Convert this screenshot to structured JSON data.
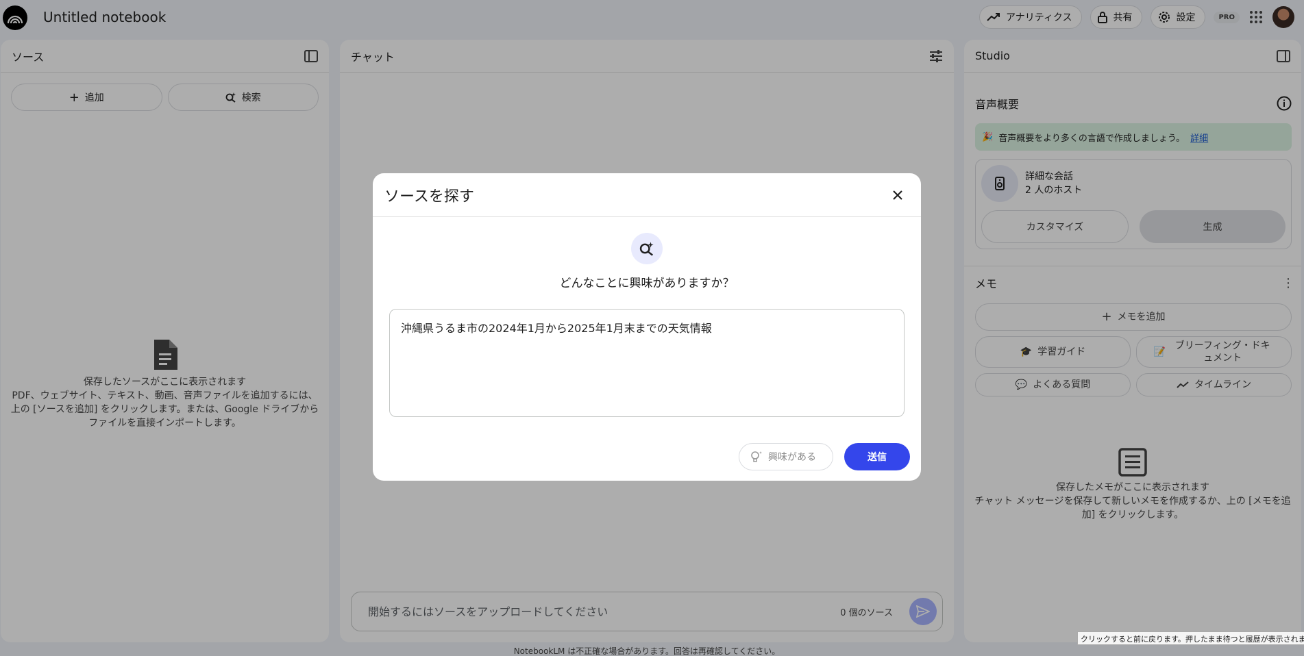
{
  "app": {
    "notebook_title": "Untitled notebook",
    "analytics_label": "アナリティクス",
    "share_label": "共有",
    "settings_label": "設定",
    "pro_badge": "PRO"
  },
  "sources": {
    "title": "ソース",
    "add_label": "追加",
    "search_label": "検索",
    "empty_title": "保存したソースがここに表示されます",
    "empty_desc": "PDF、ウェブサイト、テキスト、動画、音声ファイルを追加するには、上の [ソースを追加] をクリックします。または、Google ドライブからファイルを直接インポートします。"
  },
  "chat": {
    "title": "チャット",
    "input_placeholder": "開始するにはソースをアップロードしてください",
    "source_count": "0 個のソース",
    "disclaimer": "NotebookLM は不正確な場合があります。回答は再確認してください。"
  },
  "studio": {
    "title": "Studio",
    "audio_title": "音声概要",
    "banner_text": "音声概要をより多くの言語で作成しましょう。",
    "banner_link": "詳細",
    "audio_card_title": "詳細な会話",
    "audio_card_sub": "2 人のホスト",
    "customize_label": "カスタマイズ",
    "generate_label": "生成",
    "memo_title": "メモ",
    "add_memo_label": "メモを追加",
    "study_guide_label": "学習ガイド",
    "briefing_label": "ブリーフィング・ドキュメント",
    "faq_label": "よくある質問",
    "timeline_label": "タイムライン",
    "empty_title": "保存したメモがここに表示されます",
    "empty_desc": "チャット メッセージを保存して新しいメモを作成するか、上の [メモを追加] をクリックします。"
  },
  "dialog": {
    "title": "ソースを探す",
    "question": "どんなことに興味がありますか？",
    "query_value": "沖縄県うるま市の2024年1月から2025年1月末までの天気情報",
    "interest_label": "興味がある",
    "submit_label": "送信"
  },
  "tooltip": "クリックすると前に戻ります。押したまま待つと履歴が表示されます。",
  "colors": {
    "accent": "#3446eb",
    "banner_bg": "#dcf3e3",
    "overlay": "rgba(0,0,0,0.32)"
  }
}
